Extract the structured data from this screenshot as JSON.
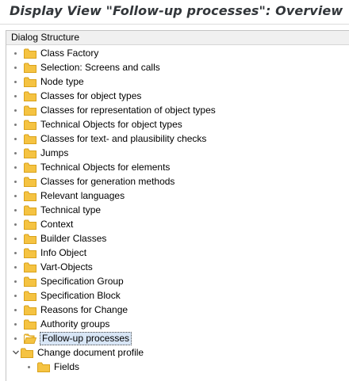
{
  "title": "Display View \"Follow-up processes\": Overview",
  "dialog_structure": {
    "header": "Dialog Structure",
    "items": [
      {
        "label": "Class Factory",
        "level": 0
      },
      {
        "label": "Selection: Screens and calls",
        "level": 0
      },
      {
        "label": "Node type",
        "level": 0
      },
      {
        "label": "Classes for object types",
        "level": 0
      },
      {
        "label": "Classes for representation of object types",
        "level": 0
      },
      {
        "label": "Technical Objects for object types",
        "level": 0
      },
      {
        "label": "Classes for text- and plausibility checks",
        "level": 0
      },
      {
        "label": "Jumps",
        "level": 0
      },
      {
        "label": "Technical Objects for elements",
        "level": 0
      },
      {
        "label": "Classes for generation methods",
        "level": 0
      },
      {
        "label": "Relevant languages",
        "level": 0
      },
      {
        "label": "Technical type",
        "level": 0
      },
      {
        "label": "Context",
        "level": 0
      },
      {
        "label": "Builder Classes",
        "level": 0
      },
      {
        "label": "Info Object",
        "level": 0
      },
      {
        "label": "Vart-Objects",
        "level": 0
      },
      {
        "label": "Specification Group",
        "level": 0
      },
      {
        "label": "Specification Block",
        "level": 0
      },
      {
        "label": "Reasons for Change",
        "level": 0
      },
      {
        "label": "Authority groups",
        "level": 0
      },
      {
        "label": "Follow-up processes",
        "level": 0,
        "selected": true,
        "icon": "folder-open-icon"
      },
      {
        "label": "Change document profile",
        "level": 0,
        "expanded": true
      },
      {
        "label": "Fields",
        "level": 1
      }
    ]
  },
  "colors": {
    "folder": "#f5c342",
    "folder_dark": "#d9a21b",
    "selection": "#d8e6f6",
    "title_text": "#32363a"
  }
}
